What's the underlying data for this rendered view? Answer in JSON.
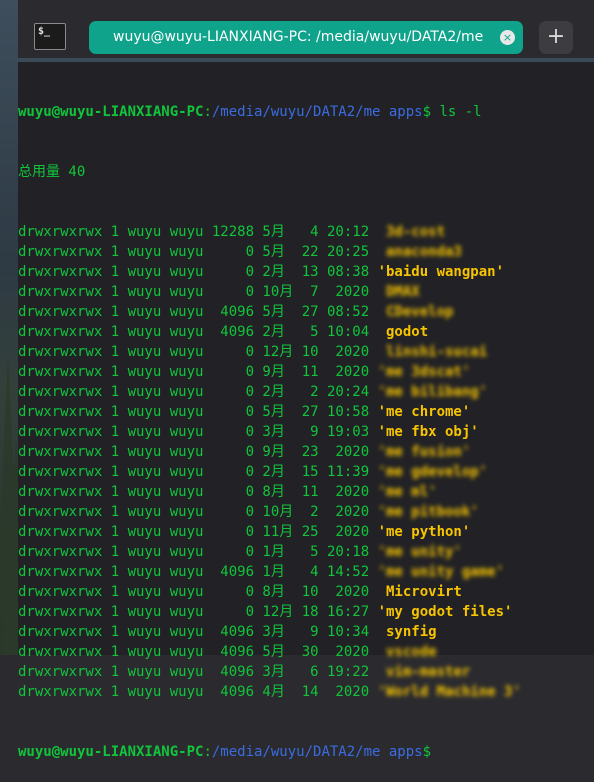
{
  "window": {
    "tab_title": "wuyu@wuyu-LIANXIANG-PC: /media/wuyu/DATA2/me apps",
    "tab_close_glyph": "×",
    "new_tab_glyph": "+",
    "terminal_icon_glyph": "$_"
  },
  "prompt": {
    "user_host": "wuyu@wuyu-LIANXIANG-PC",
    "separator": ":",
    "path": "/media/wuyu/DATA2/me apps",
    "symbol": "$"
  },
  "command": " ls -l",
  "total_line": "总用量 40",
  "listing": [
    {
      "perm": "drwxrwxrwx",
      "links": "1",
      "owner": "wuyu",
      "group": "wuyu",
      "size": "12288",
      "month": "5月",
      "day": "4",
      "time": "20:12",
      "name": "3d-cost",
      "blurred": true
    },
    {
      "perm": "drwxrwxrwx",
      "links": "1",
      "owner": "wuyu",
      "group": "wuyu",
      "size": "0",
      "month": "5月",
      "day": "22",
      "time": "20:25",
      "name": "anaconda3",
      "blurred": true
    },
    {
      "perm": "drwxrwxrwx",
      "links": "1",
      "owner": "wuyu",
      "group": "wuyu",
      "size": "0",
      "month": "2月",
      "day": "13",
      "time": "08:38",
      "name": "'baidu wangpan'",
      "blurred": false
    },
    {
      "perm": "drwxrwxrwx",
      "links": "1",
      "owner": "wuyu",
      "group": "wuyu",
      "size": "0",
      "month": "10月",
      "day": "7",
      "time": "2020",
      "name": "DMAX",
      "blurred": true
    },
    {
      "perm": "drwxrwxrwx",
      "links": "1",
      "owner": "wuyu",
      "group": "wuyu",
      "size": "4096",
      "month": "5月",
      "day": "27",
      "time": "08:52",
      "name": "CDevelop",
      "blurred": true
    },
    {
      "perm": "drwxrwxrwx",
      "links": "1",
      "owner": "wuyu",
      "group": "wuyu",
      "size": "4096",
      "month": "2月",
      "day": "5",
      "time": "10:04",
      "name": "godot",
      "blurred": false
    },
    {
      "perm": "drwxrwxrwx",
      "links": "1",
      "owner": "wuyu",
      "group": "wuyu",
      "size": "0",
      "month": "12月",
      "day": "10",
      "time": "2020",
      "name": "linshi-sucai",
      "blurred": true
    },
    {
      "perm": "drwxrwxrwx",
      "links": "1",
      "owner": "wuyu",
      "group": "wuyu",
      "size": "0",
      "month": "9月",
      "day": "11",
      "time": "2020",
      "name": "'me 3dscat'",
      "blurred": true
    },
    {
      "perm": "drwxrwxrwx",
      "links": "1",
      "owner": "wuyu",
      "group": "wuyu",
      "size": "0",
      "month": "2月",
      "day": "2",
      "time": "20:24",
      "name": "'me bilibang'",
      "blurred": true
    },
    {
      "perm": "drwxrwxrwx",
      "links": "1",
      "owner": "wuyu",
      "group": "wuyu",
      "size": "0",
      "month": "5月",
      "day": "27",
      "time": "10:58",
      "name": "'me chrome'",
      "blurred": false
    },
    {
      "perm": "drwxrwxrwx",
      "links": "1",
      "owner": "wuyu",
      "group": "wuyu",
      "size": "0",
      "month": "3月",
      "day": "9",
      "time": "19:03",
      "name": "'me fbx obj'",
      "blurred": false
    },
    {
      "perm": "drwxrwxrwx",
      "links": "1",
      "owner": "wuyu",
      "group": "wuyu",
      "size": "0",
      "month": "9月",
      "day": "23",
      "time": "2020",
      "name": "'me fusion'",
      "blurred": true
    },
    {
      "perm": "drwxrwxrwx",
      "links": "1",
      "owner": "wuyu",
      "group": "wuyu",
      "size": "0",
      "month": "2月",
      "day": "15",
      "time": "11:39",
      "name": "'me gdevelop'",
      "blurred": true
    },
    {
      "perm": "drwxrwxrwx",
      "links": "1",
      "owner": "wuyu",
      "group": "wuyu",
      "size": "0",
      "month": "8月",
      "day": "11",
      "time": "2020",
      "name": "'me ml'",
      "blurred": true
    },
    {
      "perm": "drwxrwxrwx",
      "links": "1",
      "owner": "wuyu",
      "group": "wuyu",
      "size": "0",
      "month": "10月",
      "day": "2",
      "time": "2020",
      "name": "'me pitbook'",
      "blurred": true
    },
    {
      "perm": "drwxrwxrwx",
      "links": "1",
      "owner": "wuyu",
      "group": "wuyu",
      "size": "0",
      "month": "11月",
      "day": "25",
      "time": "2020",
      "name": "'me python'",
      "blurred": false
    },
    {
      "perm": "drwxrwxrwx",
      "links": "1",
      "owner": "wuyu",
      "group": "wuyu",
      "size": "0",
      "month": "1月",
      "day": "5",
      "time": "20:18",
      "name": "'me unity'",
      "blurred": true
    },
    {
      "perm": "drwxrwxrwx",
      "links": "1",
      "owner": "wuyu",
      "group": "wuyu",
      "size": "4096",
      "month": "1月",
      "day": "4",
      "time": "14:52",
      "name": "'me unity game'",
      "blurred": true
    },
    {
      "perm": "drwxrwxrwx",
      "links": "1",
      "owner": "wuyu",
      "group": "wuyu",
      "size": "0",
      "month": "8月",
      "day": "10",
      "time": "2020",
      "name": "Microvirt",
      "blurred": false
    },
    {
      "perm": "drwxrwxrwx",
      "links": "1",
      "owner": "wuyu",
      "group": "wuyu",
      "size": "0",
      "month": "12月",
      "day": "18",
      "time": "16:27",
      "name": "'my godot files'",
      "blurred": false
    },
    {
      "perm": "drwxrwxrwx",
      "links": "1",
      "owner": "wuyu",
      "group": "wuyu",
      "size": "4096",
      "month": "3月",
      "day": "9",
      "time": "10:34",
      "name": "synfig",
      "blurred": false
    },
    {
      "perm": "drwxrwxrwx",
      "links": "1",
      "owner": "wuyu",
      "group": "wuyu",
      "size": "4096",
      "month": "5月",
      "day": "30",
      "time": "2020",
      "name": "vscode",
      "blurred": true
    },
    {
      "perm": "drwxrwxrwx",
      "links": "1",
      "owner": "wuyu",
      "group": "wuyu",
      "size": "4096",
      "month": "3月",
      "day": "6",
      "time": "19:22",
      "name": "vim-master",
      "blurred": true
    },
    {
      "perm": "drwxrwxrwx",
      "links": "1",
      "owner": "wuyu",
      "group": "wuyu",
      "size": "4096",
      "month": "4月",
      "day": "14",
      "time": "2020",
      "name": "'World Machine 3'",
      "blurred": true
    }
  ],
  "colors": {
    "tab_active": "#0fa38c",
    "prompt_green": "#11c53b",
    "path_blue": "#3a6ce0",
    "dir_yellow": "#f7c400",
    "terminal_bg": "#222226"
  }
}
